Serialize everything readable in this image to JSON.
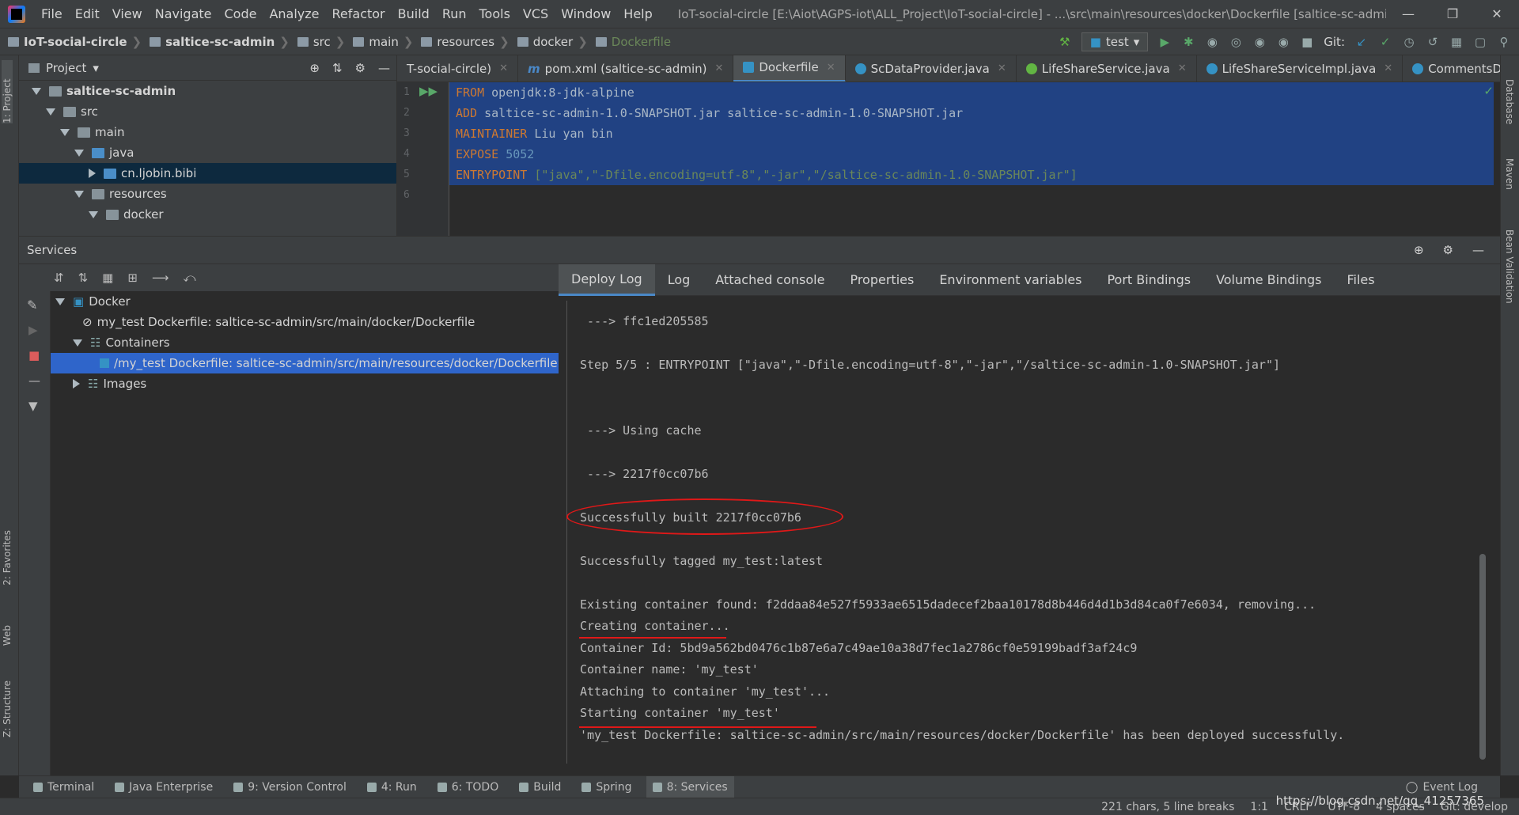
{
  "menu": {
    "items": [
      "File",
      "Edit",
      "View",
      "Navigate",
      "Code",
      "Analyze",
      "Refactor",
      "Build",
      "Run",
      "Tools",
      "VCS",
      "Window",
      "Help"
    ],
    "window_title": "IoT-social-circle [E:\\Aiot\\AGPS-iot\\ALL_Project\\IoT-social-circle] - ...\\src\\main\\resources\\docker\\Dockerfile [saltice-sc-admin]"
  },
  "nav": {
    "crumbs": [
      "IoT-social-circle",
      "saltice-sc-admin",
      "src",
      "main",
      "resources",
      "docker",
      "Dockerfile"
    ],
    "run_config": "test",
    "git_label": "Git:"
  },
  "project": {
    "title": "Project",
    "tree": [
      {
        "label": "saltice-sc-admin",
        "depth": 0,
        "expanded": true,
        "bold": true
      },
      {
        "label": "src",
        "depth": 1,
        "expanded": true
      },
      {
        "label": "main",
        "depth": 2,
        "expanded": true
      },
      {
        "label": "java",
        "depth": 3,
        "expanded": true
      },
      {
        "label": "cn.ljobin.bibi",
        "depth": 4,
        "expanded": false,
        "selected": true
      },
      {
        "label": "resources",
        "depth": 3,
        "expanded": true
      },
      {
        "label": "docker",
        "depth": 4,
        "expanded": true
      }
    ]
  },
  "editor": {
    "tabs": [
      {
        "label": "T-social-circle)",
        "icon": "none",
        "active": false
      },
      {
        "label": "pom.xml (saltice-sc-admin)",
        "icon": "maven",
        "active": false
      },
      {
        "label": "Dockerfile",
        "icon": "docker",
        "active": true
      },
      {
        "label": "ScDataProvider.java",
        "icon": "class",
        "active": false
      },
      {
        "label": "LifeShareService.java",
        "icon": "interface",
        "active": false
      },
      {
        "label": "LifeShareServiceImpl.java",
        "icon": "class",
        "active": false
      },
      {
        "label": "CommentsDao.",
        "icon": "class",
        "active": false
      }
    ],
    "line_numbers": [
      "1",
      "2",
      "3",
      "4",
      "5",
      "6"
    ],
    "lines": [
      {
        "kw": "FROM",
        "rest": " openjdk:8-jdk-alpine"
      },
      {
        "kw": "ADD",
        "rest": " saltice-sc-admin-1.0-SNAPSHOT.jar saltice-sc-admin-1.0-SNAPSHOT.jar"
      },
      {
        "kw": "MAINTAINER",
        "rest": " Liu yan bin"
      },
      {
        "kw": "EXPOSE",
        "rest": " 5052"
      },
      {
        "kw": "ENTRYPOINT",
        "rest": " [\"java\",\"-Dfile.encoding=utf-8\",\"-jar\",\"/saltice-sc-admin-1.0-SNAPSHOT.jar\"]"
      }
    ]
  },
  "services": {
    "title": "Services",
    "tree": [
      {
        "label": "Docker",
        "depth": 0
      },
      {
        "label": "my_test Dockerfile: saltice-sc-admin/src/main/docker/Dockerfile",
        "depth": 1
      },
      {
        "label": "Containers",
        "depth": 1
      },
      {
        "label": "/my_test Dockerfile: saltice-sc-admin/src/main/resources/docker/Dockerfile",
        "depth": 2,
        "selected": true
      },
      {
        "label": "Images",
        "depth": 1
      }
    ],
    "tabs": [
      "Deploy Log",
      "Log",
      "Attached console",
      "Properties",
      "Environment variables",
      "Port Bindings",
      "Volume Bindings",
      "Files"
    ],
    "log": [
      " ---> ffc1ed205585",
      "",
      "Step 5/5 : ENTRYPOINT [\"java\",\"-Dfile.encoding=utf-8\",\"-jar\",\"/saltice-sc-admin-1.0-SNAPSHOT.jar\"]",
      "",
      "",
      " ---> Using cache",
      "",
      " ---> 2217f0cc07b6",
      "",
      "Successfully built 2217f0cc07b6",
      "",
      "Successfully tagged my_test:latest",
      "",
      "Existing container found: f2ddaa84e527f5933ae6515dadecef2baa10178d8b446d4d1b3d84ca0f7e6034, removing...",
      "Creating container...",
      "Container Id: 5bd9a562bd0476c1b87e6a7c49ae10a38d7fec1a2786cf0e59199badf3af24c9",
      "Container name: 'my_test'",
      "Attaching to container 'my_test'...",
      "Starting container 'my_test'",
      "'my_test Dockerfile: saltice-sc-admin/src/main/resources/docker/Dockerfile' has been deployed successfully."
    ]
  },
  "bottom_tabs": [
    "Terminal",
    "Java Enterprise",
    "9: Version Control",
    "4: Run",
    "6: TODO",
    "Build",
    "Spring",
    "8: Services"
  ],
  "event_log": "Event Log",
  "left_tabs": [
    "1: Project",
    "2: Favorites",
    "Web",
    "Z: Structure"
  ],
  "right_tabs": [
    "Database",
    "Maven",
    "Bean Validation"
  ],
  "status": {
    "chars": "221 chars, 5 line breaks",
    "position": "1:1",
    "line_sep": "CRLF",
    "encoding": "UTF-8",
    "indent": "4 spaces",
    "vcs": "Git: develop",
    "watermark": "https://blog.csdn.net/qq_41257365"
  },
  "colors": {
    "keyword": "#cc7832",
    "selection": "#214283",
    "annotation": "#e01818",
    "active_tab": "#4a88c7"
  }
}
